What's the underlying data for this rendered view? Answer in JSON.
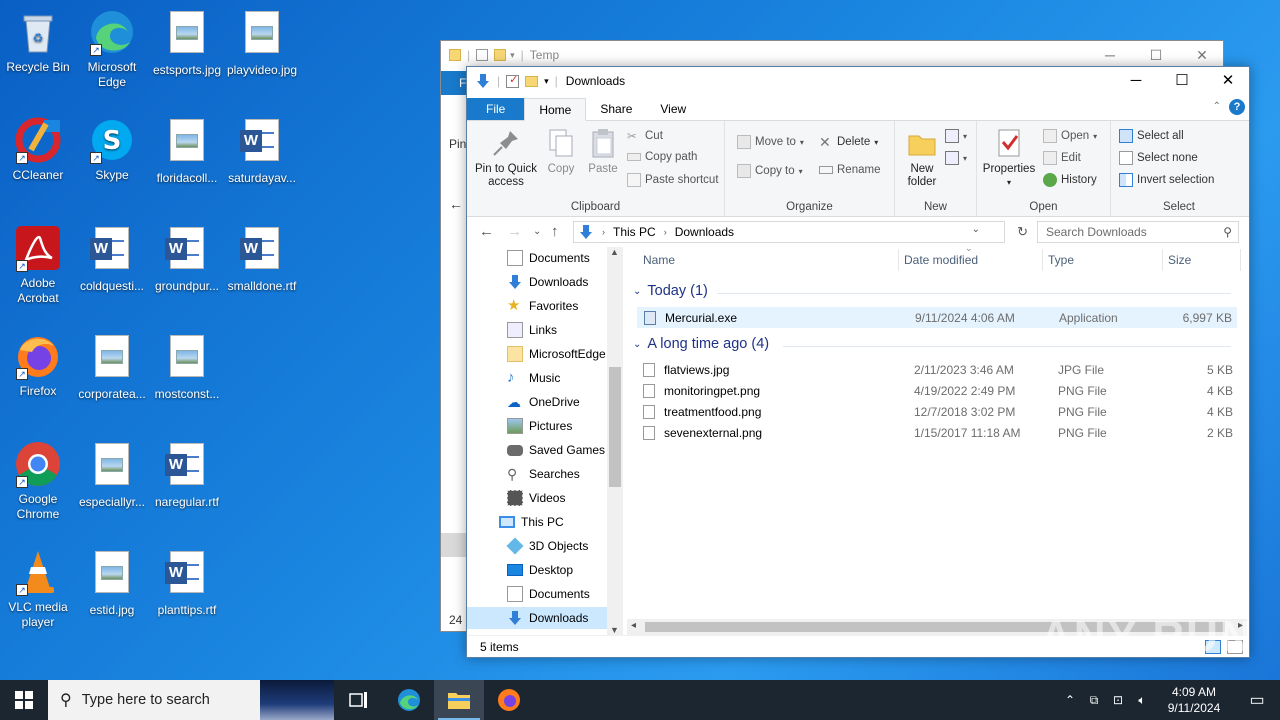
{
  "desktop": {
    "icons": [
      {
        "label": "Recycle Bin"
      },
      {
        "label": "Microsoft Edge"
      },
      {
        "label": "estsports.jpg"
      },
      {
        "label": "playvideo.jpg"
      },
      {
        "label": "CCleaner"
      },
      {
        "label": "Skype"
      },
      {
        "label": "floridacoll..."
      },
      {
        "label": "saturdayav..."
      },
      {
        "label": "Adobe Acrobat"
      },
      {
        "label": "coldquesti..."
      },
      {
        "label": "groundpur..."
      },
      {
        "label": "smalldone.rtf"
      },
      {
        "label": "Firefox"
      },
      {
        "label": "corporatea..."
      },
      {
        "label": "mostconst..."
      },
      {
        "label": "Google Chrome"
      },
      {
        "label": "especiallyr..."
      },
      {
        "label": "naregular.rtf"
      },
      {
        "label": "VLC media player"
      },
      {
        "label": "estid.jpg"
      },
      {
        "label": "planttips.rtf"
      }
    ]
  },
  "back_window": {
    "title": "Temp",
    "left_text_1": "Pin",
    "left_text_2": "24"
  },
  "window": {
    "title": "Downloads",
    "tabs": {
      "file": "File",
      "home": "Home",
      "share": "Share",
      "view": "View"
    },
    "ribbon": {
      "clipboard": {
        "pin": "Pin to Quick access",
        "copy": "Copy",
        "paste": "Paste",
        "cut": "Cut",
        "copy_path": "Copy path",
        "paste_shortcut": "Paste shortcut",
        "label": "Clipboard"
      },
      "organize": {
        "move_to": "Move to",
        "copy_to": "Copy to",
        "delete": "Delete",
        "rename": "Rename",
        "label": "Organize"
      },
      "new": {
        "new_folder": "New folder",
        "label": "New"
      },
      "open": {
        "properties": "Properties",
        "open": "Open",
        "edit": "Edit",
        "history": "History",
        "label": "Open"
      },
      "select": {
        "select_all": "Select all",
        "select_none": "Select none",
        "invert": "Invert selection",
        "label": "Select"
      }
    },
    "address": {
      "crumb1": "This PC",
      "crumb2": "Downloads"
    },
    "search": {
      "placeholder": "Search Downloads"
    },
    "nav": [
      {
        "label": "Documents"
      },
      {
        "label": "Downloads"
      },
      {
        "label": "Favorites"
      },
      {
        "label": "Links"
      },
      {
        "label": "MicrosoftEdge"
      },
      {
        "label": "Music"
      },
      {
        "label": "OneDrive"
      },
      {
        "label": "Pictures"
      },
      {
        "label": "Saved Games"
      },
      {
        "label": "Searches"
      },
      {
        "label": "Videos"
      },
      {
        "label": "This PC"
      },
      {
        "label": "3D Objects"
      },
      {
        "label": "Desktop"
      },
      {
        "label": "Documents"
      },
      {
        "label": "Downloads"
      }
    ],
    "columns": {
      "name": "Name",
      "date": "Date modified",
      "type": "Type",
      "size": "Size"
    },
    "groups": [
      {
        "title": "Today (1)",
        "files": [
          {
            "name": "Mercurial.exe",
            "date": "9/11/2024 4:06 AM",
            "type": "Application",
            "size": "6,997 KB"
          }
        ]
      },
      {
        "title": "A long time ago (4)",
        "files": [
          {
            "name": "flatviews.jpg",
            "date": "2/11/2023 3:46 AM",
            "type": "JPG File",
            "size": "5 KB"
          },
          {
            "name": "monitoringpet.png",
            "date": "4/19/2022 2:49 PM",
            "type": "PNG File",
            "size": "4 KB"
          },
          {
            "name": "treatmentfood.png",
            "date": "12/7/2018 3:02 PM",
            "type": "PNG File",
            "size": "4 KB"
          },
          {
            "name": "sevenexternal.png",
            "date": "1/15/2017 11:18 AM",
            "type": "PNG File",
            "size": "2 KB"
          }
        ]
      }
    ],
    "status": "5 items"
  },
  "taskbar": {
    "search_placeholder": "Type here to search",
    "time": "4:09 AM",
    "date": "9/11/2024"
  },
  "watermark": "ANY RUN",
  "colors": {
    "accent": "#1979ca",
    "taskbar": "#1b2631",
    "selection": "#e5f3ff"
  }
}
